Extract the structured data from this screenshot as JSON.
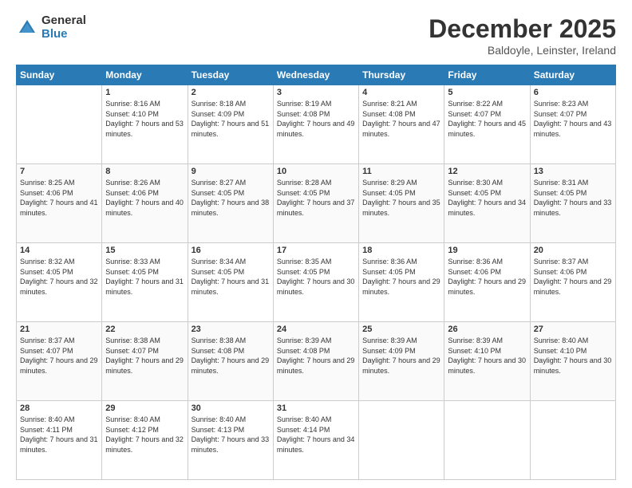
{
  "logo": {
    "general": "General",
    "blue": "Blue"
  },
  "title": {
    "month": "December 2025",
    "location": "Baldoyle, Leinster, Ireland"
  },
  "weekdays": [
    "Sunday",
    "Monday",
    "Tuesday",
    "Wednesday",
    "Thursday",
    "Friday",
    "Saturday"
  ],
  "weeks": [
    [
      {
        "day": "",
        "sunrise": "",
        "sunset": "",
        "daylight": ""
      },
      {
        "day": "1",
        "sunrise": "Sunrise: 8:16 AM",
        "sunset": "Sunset: 4:10 PM",
        "daylight": "Daylight: 7 hours and 53 minutes."
      },
      {
        "day": "2",
        "sunrise": "Sunrise: 8:18 AM",
        "sunset": "Sunset: 4:09 PM",
        "daylight": "Daylight: 7 hours and 51 minutes."
      },
      {
        "day": "3",
        "sunrise": "Sunrise: 8:19 AM",
        "sunset": "Sunset: 4:08 PM",
        "daylight": "Daylight: 7 hours and 49 minutes."
      },
      {
        "day": "4",
        "sunrise": "Sunrise: 8:21 AM",
        "sunset": "Sunset: 4:08 PM",
        "daylight": "Daylight: 7 hours and 47 minutes."
      },
      {
        "day": "5",
        "sunrise": "Sunrise: 8:22 AM",
        "sunset": "Sunset: 4:07 PM",
        "daylight": "Daylight: 7 hours and 45 minutes."
      },
      {
        "day": "6",
        "sunrise": "Sunrise: 8:23 AM",
        "sunset": "Sunset: 4:07 PM",
        "daylight": "Daylight: 7 hours and 43 minutes."
      }
    ],
    [
      {
        "day": "7",
        "sunrise": "Sunrise: 8:25 AM",
        "sunset": "Sunset: 4:06 PM",
        "daylight": "Daylight: 7 hours and 41 minutes."
      },
      {
        "day": "8",
        "sunrise": "Sunrise: 8:26 AM",
        "sunset": "Sunset: 4:06 PM",
        "daylight": "Daylight: 7 hours and 40 minutes."
      },
      {
        "day": "9",
        "sunrise": "Sunrise: 8:27 AM",
        "sunset": "Sunset: 4:05 PM",
        "daylight": "Daylight: 7 hours and 38 minutes."
      },
      {
        "day": "10",
        "sunrise": "Sunrise: 8:28 AM",
        "sunset": "Sunset: 4:05 PM",
        "daylight": "Daylight: 7 hours and 37 minutes."
      },
      {
        "day": "11",
        "sunrise": "Sunrise: 8:29 AM",
        "sunset": "Sunset: 4:05 PM",
        "daylight": "Daylight: 7 hours and 35 minutes."
      },
      {
        "day": "12",
        "sunrise": "Sunrise: 8:30 AM",
        "sunset": "Sunset: 4:05 PM",
        "daylight": "Daylight: 7 hours and 34 minutes."
      },
      {
        "day": "13",
        "sunrise": "Sunrise: 8:31 AM",
        "sunset": "Sunset: 4:05 PM",
        "daylight": "Daylight: 7 hours and 33 minutes."
      }
    ],
    [
      {
        "day": "14",
        "sunrise": "Sunrise: 8:32 AM",
        "sunset": "Sunset: 4:05 PM",
        "daylight": "Daylight: 7 hours and 32 minutes."
      },
      {
        "day": "15",
        "sunrise": "Sunrise: 8:33 AM",
        "sunset": "Sunset: 4:05 PM",
        "daylight": "Daylight: 7 hours and 31 minutes."
      },
      {
        "day": "16",
        "sunrise": "Sunrise: 8:34 AM",
        "sunset": "Sunset: 4:05 PM",
        "daylight": "Daylight: 7 hours and 31 minutes."
      },
      {
        "day": "17",
        "sunrise": "Sunrise: 8:35 AM",
        "sunset": "Sunset: 4:05 PM",
        "daylight": "Daylight: 7 hours and 30 minutes."
      },
      {
        "day": "18",
        "sunrise": "Sunrise: 8:36 AM",
        "sunset": "Sunset: 4:05 PM",
        "daylight": "Daylight: 7 hours and 29 minutes."
      },
      {
        "day": "19",
        "sunrise": "Sunrise: 8:36 AM",
        "sunset": "Sunset: 4:06 PM",
        "daylight": "Daylight: 7 hours and 29 minutes."
      },
      {
        "day": "20",
        "sunrise": "Sunrise: 8:37 AM",
        "sunset": "Sunset: 4:06 PM",
        "daylight": "Daylight: 7 hours and 29 minutes."
      }
    ],
    [
      {
        "day": "21",
        "sunrise": "Sunrise: 8:37 AM",
        "sunset": "Sunset: 4:07 PM",
        "daylight": "Daylight: 7 hours and 29 minutes."
      },
      {
        "day": "22",
        "sunrise": "Sunrise: 8:38 AM",
        "sunset": "Sunset: 4:07 PM",
        "daylight": "Daylight: 7 hours and 29 minutes."
      },
      {
        "day": "23",
        "sunrise": "Sunrise: 8:38 AM",
        "sunset": "Sunset: 4:08 PM",
        "daylight": "Daylight: 7 hours and 29 minutes."
      },
      {
        "day": "24",
        "sunrise": "Sunrise: 8:39 AM",
        "sunset": "Sunset: 4:08 PM",
        "daylight": "Daylight: 7 hours and 29 minutes."
      },
      {
        "day": "25",
        "sunrise": "Sunrise: 8:39 AM",
        "sunset": "Sunset: 4:09 PM",
        "daylight": "Daylight: 7 hours and 29 minutes."
      },
      {
        "day": "26",
        "sunrise": "Sunrise: 8:39 AM",
        "sunset": "Sunset: 4:10 PM",
        "daylight": "Daylight: 7 hours and 30 minutes."
      },
      {
        "day": "27",
        "sunrise": "Sunrise: 8:40 AM",
        "sunset": "Sunset: 4:10 PM",
        "daylight": "Daylight: 7 hours and 30 minutes."
      }
    ],
    [
      {
        "day": "28",
        "sunrise": "Sunrise: 8:40 AM",
        "sunset": "Sunset: 4:11 PM",
        "daylight": "Daylight: 7 hours and 31 minutes."
      },
      {
        "day": "29",
        "sunrise": "Sunrise: 8:40 AM",
        "sunset": "Sunset: 4:12 PM",
        "daylight": "Daylight: 7 hours and 32 minutes."
      },
      {
        "day": "30",
        "sunrise": "Sunrise: 8:40 AM",
        "sunset": "Sunset: 4:13 PM",
        "daylight": "Daylight: 7 hours and 33 minutes."
      },
      {
        "day": "31",
        "sunrise": "Sunrise: 8:40 AM",
        "sunset": "Sunset: 4:14 PM",
        "daylight": "Daylight: 7 hours and 34 minutes."
      },
      {
        "day": "",
        "sunrise": "",
        "sunset": "",
        "daylight": ""
      },
      {
        "day": "",
        "sunrise": "",
        "sunset": "",
        "daylight": ""
      },
      {
        "day": "",
        "sunrise": "",
        "sunset": "",
        "daylight": ""
      }
    ]
  ]
}
